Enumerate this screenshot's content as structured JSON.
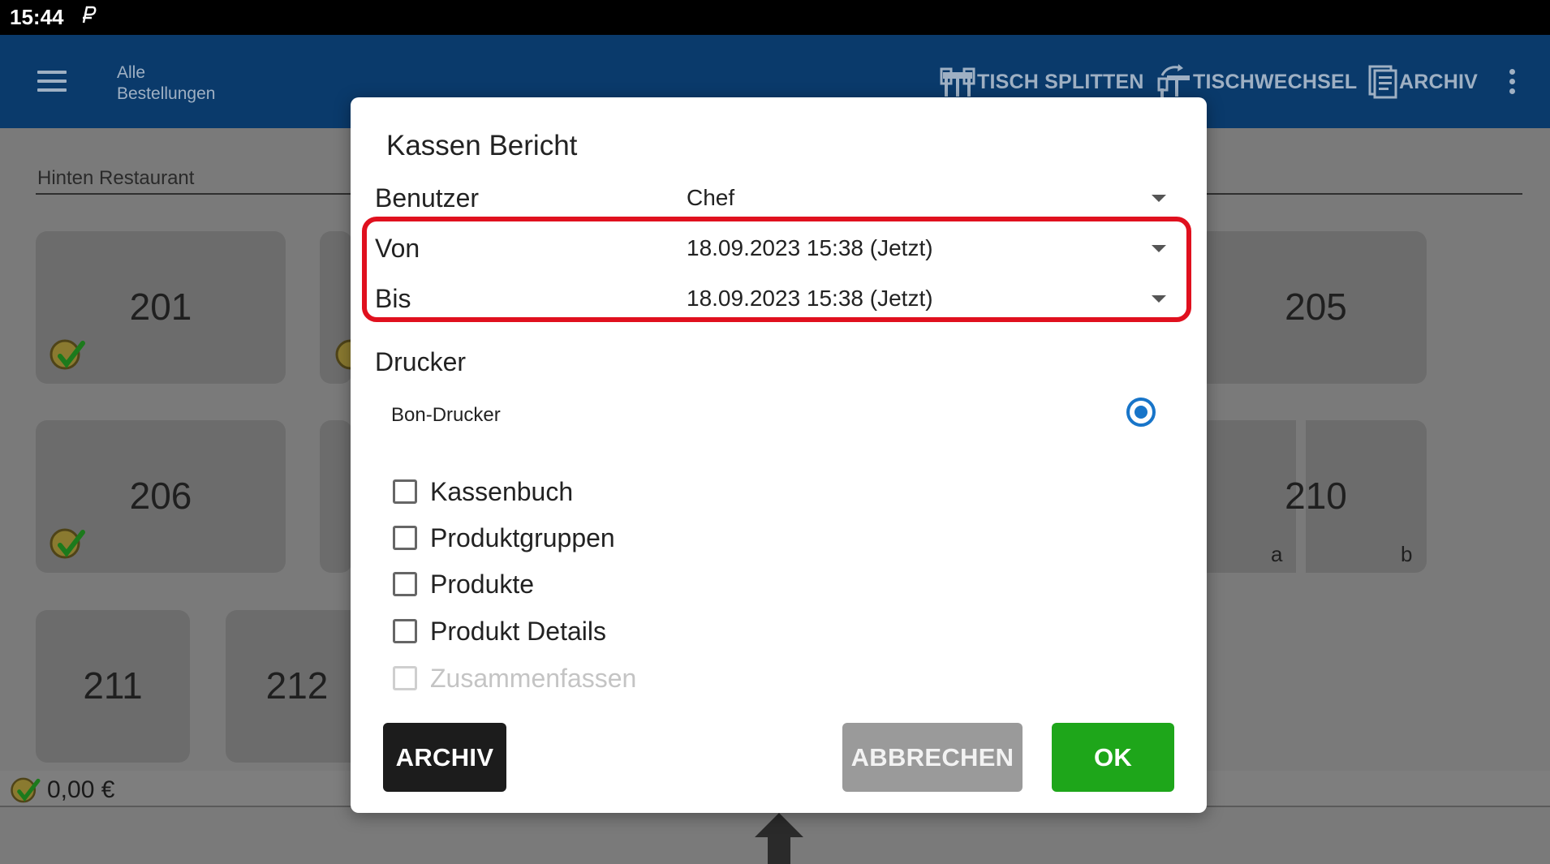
{
  "status_bar": {
    "time": "15:44",
    "icon": "p-notification-icon"
  },
  "app_bar": {
    "title": "Alle Bestellungen",
    "actions": [
      {
        "label": "TISCH SPLITTEN",
        "icon": "table-split-icon"
      },
      {
        "label": "TISCHWECHSEL",
        "icon": "table-change-icon"
      },
      {
        "label": "ARCHIV",
        "icon": "archive-icon"
      }
    ]
  },
  "area": {
    "label": "Hinten Restaurant"
  },
  "tables": [
    {
      "number": "201"
    },
    {
      "number": "205"
    },
    {
      "number": "206"
    },
    {
      "number": "210",
      "sub_a": "a",
      "sub_b": "b"
    },
    {
      "number": "211"
    },
    {
      "number": "212"
    }
  ],
  "footer": {
    "total": "0,00 €"
  },
  "dialog": {
    "title": "Kassen Bericht",
    "user": {
      "label": "Benutzer",
      "value": "Chef"
    },
    "from": {
      "label": "Von",
      "value": "18.09.2023 15:38 (Jetzt)"
    },
    "to": {
      "label": "Bis",
      "value": "18.09.2023 15:38 (Jetzt)"
    },
    "printer_section": "Drucker",
    "printer_option": "Bon-Drucker",
    "options": [
      {
        "label": "Kassenbuch",
        "checked": false,
        "enabled": true
      },
      {
        "label": "Produktgruppen",
        "checked": false,
        "enabled": true
      },
      {
        "label": "Produkte",
        "checked": false,
        "enabled": true
      },
      {
        "label": "Produkt Details",
        "checked": false,
        "enabled": true
      },
      {
        "label": "Zusammenfassen",
        "checked": false,
        "enabled": false
      }
    ],
    "buttons": {
      "archive": "ARCHIV",
      "cancel": "ABBRECHEN",
      "ok": "OK"
    }
  },
  "colors": {
    "appbar": "#0a3a6b",
    "highlight": "#e0101e",
    "radio": "#1875c9",
    "ok_button": "#1ea61a",
    "archive_button": "#1c1c1c",
    "cancel_button": "#9a9a9a"
  }
}
